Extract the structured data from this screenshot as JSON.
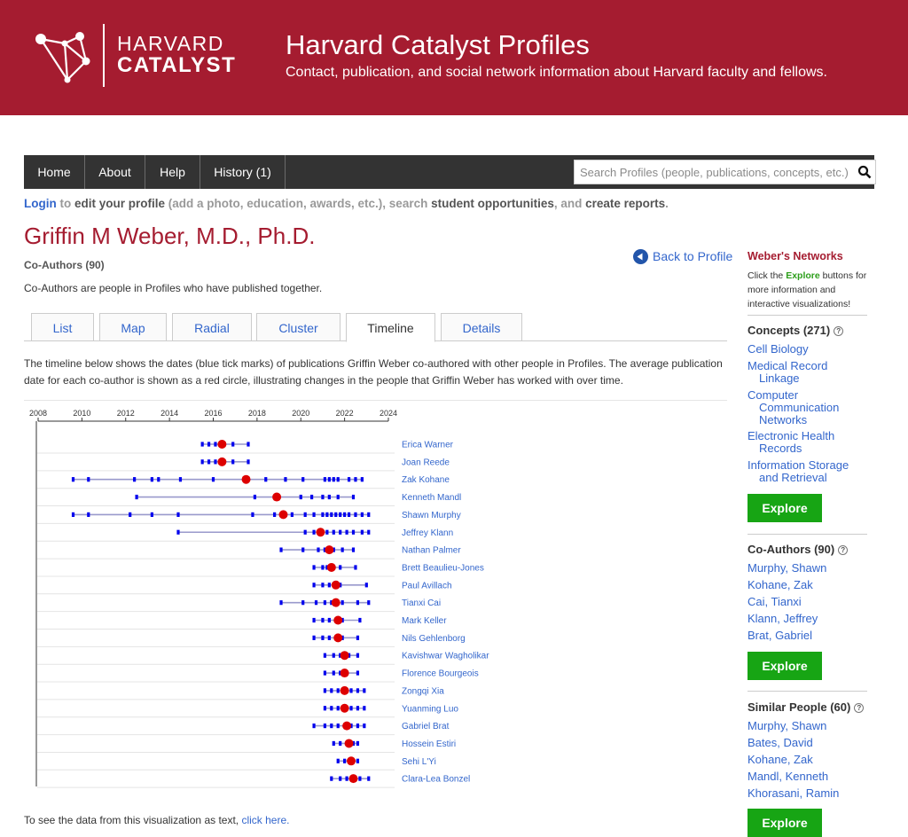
{
  "header": {
    "logo_line1": "HARVARD",
    "logo_line2": "CATALYST",
    "title": "Harvard Catalyst Profiles",
    "subtitle": "Contact, publication, and social network information about Harvard faculty and fellows."
  },
  "nav": {
    "items": [
      "Home",
      "About",
      "Help",
      "History (1)"
    ],
    "search_placeholder": "Search Profiles (people, publications, concepts, etc.)"
  },
  "login_line": {
    "login": "Login",
    "to": " to ",
    "edit": "edit your profile",
    "mid": " (add a photo, education, awards, etc.), search ",
    "opps": "student opportunities",
    "and": ", and ",
    "reports": "create reports",
    "end": "."
  },
  "profile": {
    "name": "Griffin M Weber, M.D., Ph.D.",
    "section_title": "Co-Authors (90)",
    "section_desc": "Co-Authors are people in Profiles who have published together.",
    "back_label": "Back to Profile"
  },
  "tabs": [
    "List",
    "Map",
    "Radial",
    "Cluster",
    "Timeline",
    "Details"
  ],
  "active_tab": "Timeline",
  "intro": "The timeline below shows the dates (blue tick marks) of publications Griffin Weber co-authored with other people in Profiles. The average publication date for each co-author is shown as a red circle, illustrating changes in the people that Griffin Weber has worked with over time.",
  "footer": {
    "text": "To see the data from this visualization as text, ",
    "link": "click here."
  },
  "sidebar": {
    "networks_title": "Weber's Networks",
    "networks_desc_pre": "Click the ",
    "networks_desc_explore": "Explore",
    "networks_desc_post": " buttons for more information and interactive visualizations!",
    "explore_label": "Explore",
    "concepts": {
      "title": "Concepts (271)",
      "items": [
        [
          "Cell Biology"
        ],
        [
          "Medical Record",
          "Linkage"
        ],
        [
          "Computer",
          "Communication",
          "Networks"
        ],
        [
          "Electronic Health",
          "Records"
        ],
        [
          "Information Storage",
          "and Retrieval"
        ]
      ]
    },
    "coauthors": {
      "title": "Co-Authors (90)",
      "items": [
        "Murphy, Shawn",
        "Kohane, Zak",
        "Cai, Tianxi",
        "Klann, Jeffrey",
        "Brat, Gabriel"
      ]
    },
    "similar": {
      "title": "Similar People (60)",
      "items": [
        "Murphy, Shawn",
        "Bates, David",
        "Kohane, Zak",
        "Mandl, Kenneth",
        "Khorasani, Ramin"
      ]
    }
  },
  "colors": {
    "brand": "#a51c30",
    "nav_bg": "#333333",
    "link": "#3366cc",
    "explore": "#17a514",
    "tick": "#0000ee",
    "average": "#dd0000",
    "line": "#9999cc"
  },
  "chart_data": {
    "type": "scatter",
    "x_axis": {
      "min": 2008,
      "max": 2024,
      "ticks": [
        2008,
        2010,
        2012,
        2014,
        2016,
        2018,
        2020,
        2022,
        2024
      ]
    },
    "rows": [
      {
        "name": "Erica Warner",
        "pubs": [
          2015.5,
          2015.8,
          2016.1,
          2016.5,
          2016.9,
          2017.6
        ],
        "avg": 2016.4
      },
      {
        "name": "Joan Reede",
        "pubs": [
          2015.5,
          2015.8,
          2016.1,
          2016.5,
          2016.9,
          2017.6
        ],
        "avg": 2016.4
      },
      {
        "name": "Zak Kohane",
        "pubs": [
          2009.6,
          2010.3,
          2012.4,
          2013.2,
          2013.5,
          2014.5,
          2016.0,
          2017.5,
          2018.4,
          2019.3,
          2020.1,
          2021.1,
          2021.3,
          2021.5,
          2021.7,
          2022.2,
          2022.5,
          2022.8
        ],
        "avg": 2017.5
      },
      {
        "name": "Kenneth Mandl",
        "pubs": [
          2012.5,
          2017.9,
          2018.8,
          2020.0,
          2020.5,
          2021.0,
          2021.3,
          2021.7,
          2022.4
        ],
        "avg": 2018.9
      },
      {
        "name": "Shawn Murphy",
        "pubs": [
          2009.6,
          2010.3,
          2012.2,
          2013.2,
          2014.4,
          2017.8,
          2018.8,
          2019.6,
          2020.2,
          2020.6,
          2021.0,
          2021.2,
          2021.4,
          2021.6,
          2021.8,
          2022.0,
          2022.2,
          2022.5,
          2022.8,
          2023.1
        ],
        "avg": 2019.2
      },
      {
        "name": "Jeffrey Klann",
        "pubs": [
          2014.4,
          2020.2,
          2020.6,
          2020.9,
          2021.2,
          2021.5,
          2021.8,
          2022.1,
          2022.4,
          2022.8,
          2023.1
        ],
        "avg": 2020.9
      },
      {
        "name": "Nathan Palmer",
        "pubs": [
          2019.1,
          2020.1,
          2020.8,
          2021.1,
          2021.5,
          2021.9,
          2022.4
        ],
        "avg": 2021.3
      },
      {
        "name": "Brett Beaulieu-Jones",
        "pubs": [
          2020.6,
          2021.0,
          2021.2,
          2021.5,
          2021.8,
          2022.5
        ],
        "avg": 2021.4
      },
      {
        "name": "Paul Avillach",
        "pubs": [
          2020.6,
          2021.0,
          2021.3,
          2021.5,
          2021.8,
          2023.0
        ],
        "avg": 2021.6
      },
      {
        "name": "Tianxi Cai",
        "pubs": [
          2019.1,
          2020.1,
          2020.7,
          2021.1,
          2021.4,
          2021.6,
          2021.9,
          2022.6,
          2023.1
        ],
        "avg": 2021.6
      },
      {
        "name": "Mark Keller",
        "pubs": [
          2020.6,
          2021.0,
          2021.3,
          2021.6,
          2021.9,
          2022.7
        ],
        "avg": 2021.7
      },
      {
        "name": "Nils Gehlenborg",
        "pubs": [
          2020.6,
          2021.0,
          2021.3,
          2021.6,
          2021.9,
          2022.6
        ],
        "avg": 2021.7
      },
      {
        "name": "Kavishwar Wagholikar",
        "pubs": [
          2021.1,
          2021.5,
          2021.8,
          2022.0,
          2022.2,
          2022.6
        ],
        "avg": 2022.0
      },
      {
        "name": "Florence Bourgeois",
        "pubs": [
          2021.1,
          2021.5,
          2021.8,
          2022.1,
          2022.6
        ],
        "avg": 2022.0
      },
      {
        "name": "Zongqi Xia",
        "pubs": [
          2021.1,
          2021.4,
          2021.7,
          2022.0,
          2022.3,
          2022.6,
          2022.9
        ],
        "avg": 2022.0
      },
      {
        "name": "Yuanming Luo",
        "pubs": [
          2021.1,
          2021.4,
          2021.7,
          2022.0,
          2022.3,
          2022.6,
          2022.9
        ],
        "avg": 2022.0
      },
      {
        "name": "Gabriel Brat",
        "pubs": [
          2020.6,
          2021.1,
          2021.4,
          2021.7,
          2022.0,
          2022.3,
          2022.6,
          2022.9
        ],
        "avg": 2022.1
      },
      {
        "name": "Hossein Estiri",
        "pubs": [
          2021.5,
          2021.8,
          2022.1,
          2022.4,
          2022.6
        ],
        "avg": 2022.2
      },
      {
        "name": "Sehi L'Yi",
        "pubs": [
          2021.7,
          2022.0,
          2022.3,
          2022.6
        ],
        "avg": 2022.3
      },
      {
        "name": "Clara-Lea Bonzel",
        "pubs": [
          2021.4,
          2021.8,
          2022.1,
          2022.4,
          2022.7,
          2023.1
        ],
        "avg": 2022.4
      }
    ]
  }
}
